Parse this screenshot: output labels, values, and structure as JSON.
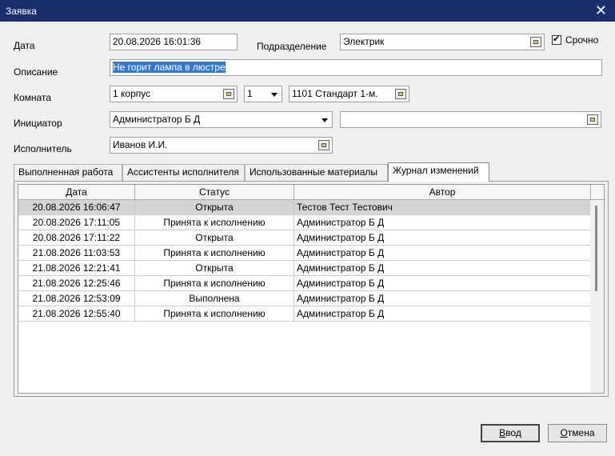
{
  "window": {
    "title": "Заявка",
    "close_glyph": "✕"
  },
  "form": {
    "date_label": "Дата",
    "date_value": "20.08.2026 16:01:36",
    "department_label": "Подразделение",
    "department_value": "Электрик",
    "urgent_label": "Срочно",
    "urgent_checked": true,
    "description_label": "Описание",
    "description_value": "Не горит лампа в люстре",
    "room_label": "Комната",
    "room_building": "1 корпус",
    "room_floor": "1",
    "room_value": "1101  Стандарт 1-м.",
    "initiator_label": "Инициатор",
    "initiator_value": "Администратор Б Д",
    "initiator_extra": "",
    "executor_label": "Исполнитель",
    "executor_value": "Иванов И.И."
  },
  "tabs": [
    {
      "label": "Выполненная работа",
      "active": false
    },
    {
      "label": "Ассистенты исполнителя",
      "active": false
    },
    {
      "label": "Использованные материалы",
      "active": false
    },
    {
      "label": "Журнал изменений",
      "active": true
    }
  ],
  "log_table": {
    "columns": [
      "Дата",
      "Статус",
      "Автор"
    ],
    "rows": [
      {
        "date": "20.08.2026 16:06:47",
        "status": "Открыта",
        "author": "Тестов Тест Тестович",
        "selected": true
      },
      {
        "date": "20.08.2026 17:11:05",
        "status": "Принята к исполнению",
        "author": "Администратор Б Д"
      },
      {
        "date": "20.08.2026 17:11:22",
        "status": "Открыта",
        "author": "Администратор Б Д"
      },
      {
        "date": "21.08.2026 11:03:53",
        "status": "Принята к исполнению",
        "author": "Администратор Б Д"
      },
      {
        "date": "21.08.2026 12:21:41",
        "status": "Открыта",
        "author": "Администратор Б Д"
      },
      {
        "date": "21.08.2026 12:25:46",
        "status": "Принята к исполнению",
        "author": "Администратор Б Д"
      },
      {
        "date": "21.08.2026 12:53:09",
        "status": "Выполнена",
        "author": "Администратор Б Д"
      },
      {
        "date": "21.08.2026 12:55:40",
        "status": "Принята к исполнению",
        "author": "Администратор Б Д"
      }
    ]
  },
  "buttons": {
    "ok_first": "В",
    "ok_rest": "вод",
    "cancel_first": "О",
    "cancel_rest": "тмена"
  },
  "colors": {
    "titlebar": "#1a2e6e",
    "selection": "#3478d2",
    "selected_row": "#d4d4d4"
  }
}
